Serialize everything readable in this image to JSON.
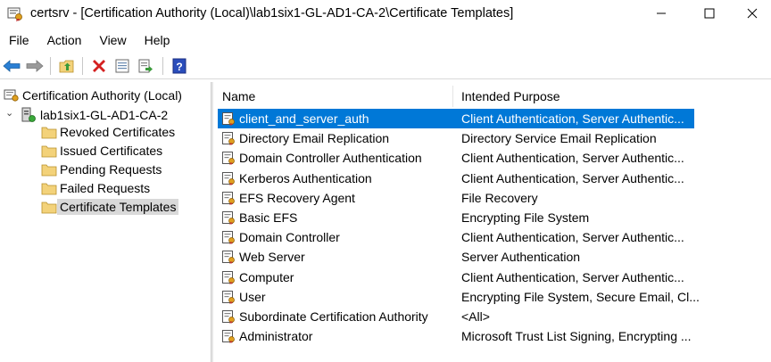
{
  "window": {
    "title": "certsrv - [Certification Authority (Local)\\lab1six1-GL-AD1-CA-2\\Certificate Templates]",
    "minimize_glyph": "—",
    "maximize_glyph": "☐",
    "close_glyph": "✕"
  },
  "menu": [
    "File",
    "Action",
    "View",
    "Help"
  ],
  "toolbar": {
    "icons": [
      "back-arrow-icon",
      "forward-arrow-icon",
      "up-folder-icon",
      "delete-icon",
      "properties-icon",
      "export-list-icon",
      "help-icon"
    ],
    "help_glyph": "?"
  },
  "tree": {
    "root": "Certification Authority (Local)",
    "ca": "lab1six1-GL-AD1-CA-2",
    "caret": "⌄",
    "children": [
      "Revoked Certificates",
      "Issued Certificates",
      "Pending Requests",
      "Failed Requests",
      "Certificate Templates"
    ]
  },
  "list": {
    "columns": [
      "Name",
      "Intended Purpose"
    ],
    "rows": [
      {
        "name": "client_and_server_auth",
        "purpose": "Client Authentication, Server Authentic..."
      },
      {
        "name": "Directory Email Replication",
        "purpose": "Directory Service Email Replication"
      },
      {
        "name": "Domain Controller Authentication",
        "purpose": "Client Authentication, Server Authentic..."
      },
      {
        "name": "Kerberos Authentication",
        "purpose": "Client Authentication, Server Authentic..."
      },
      {
        "name": "EFS Recovery Agent",
        "purpose": "File Recovery"
      },
      {
        "name": "Basic EFS",
        "purpose": "Encrypting File System"
      },
      {
        "name": "Domain Controller",
        "purpose": "Client Authentication, Server Authentic..."
      },
      {
        "name": "Web Server",
        "purpose": "Server Authentication"
      },
      {
        "name": "Computer",
        "purpose": "Client Authentication, Server Authentic..."
      },
      {
        "name": "User",
        "purpose": "Encrypting File System, Secure Email, Cl..."
      },
      {
        "name": "Subordinate Certification Authority",
        "purpose": "<All>"
      },
      {
        "name": "Administrator",
        "purpose": "Microsoft Trust List Signing, Encrypting ..."
      }
    ]
  },
  "colors": {
    "selection": "#0078d7",
    "tree_selection": "#d9d9d9",
    "folder": "#f3d27a",
    "delete_red": "#d42020",
    "help_blue": "#2a4dbb",
    "arrow_blue": "#2a7fd4"
  }
}
